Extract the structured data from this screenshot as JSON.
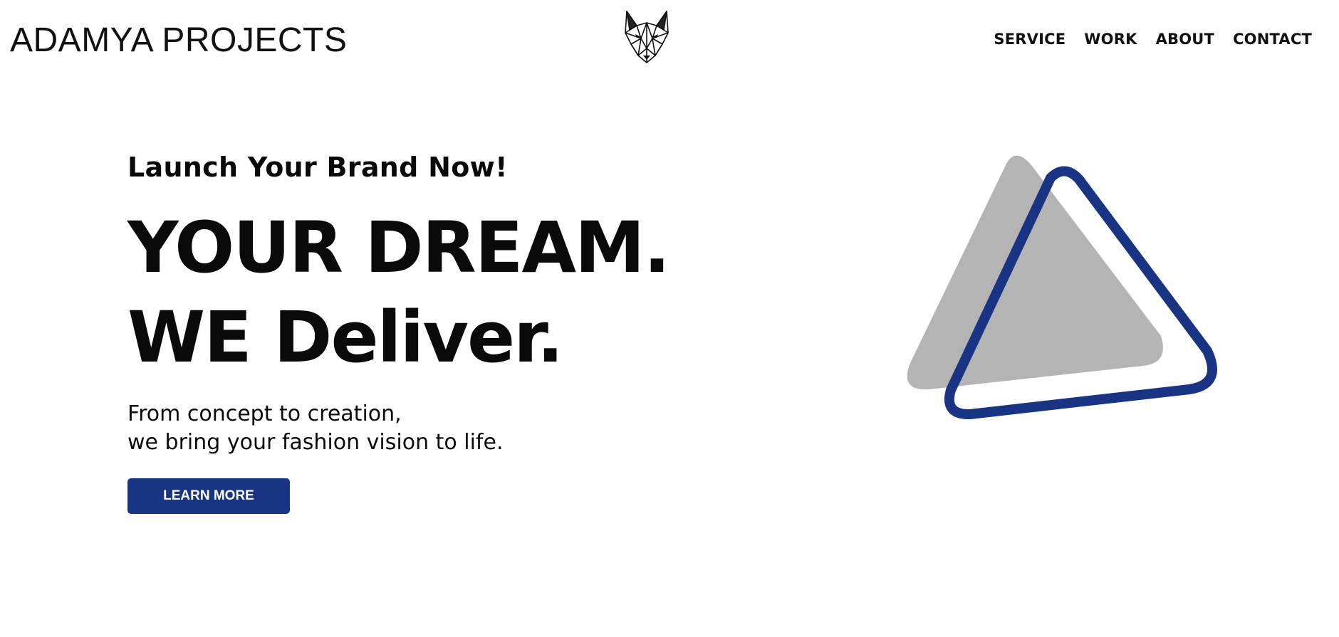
{
  "header": {
    "brand": "ADAMYA PROJECTS",
    "logo_icon": "wolf-head-icon",
    "nav": [
      {
        "label": "SERVICE"
      },
      {
        "label": "WORK"
      },
      {
        "label": "ABOUT"
      },
      {
        "label": "CONTACT"
      }
    ]
  },
  "hero": {
    "tagline": "Launch Your Brand Now!",
    "headline_line1": "YOUR DREAM.",
    "headline_line2": "WE Deliver.",
    "sub_line1": "From concept to creation,",
    "sub_line2": "we bring your fashion vision to life.",
    "cta_label": "LEARN MORE"
  },
  "art": {
    "icon": "triangles-graphic",
    "fill_color": "#b4b4b4",
    "outline_color": "#1a3484"
  },
  "colors": {
    "accent": "#1a3484",
    "text": "#0a0a0a",
    "background": "#ffffff"
  }
}
